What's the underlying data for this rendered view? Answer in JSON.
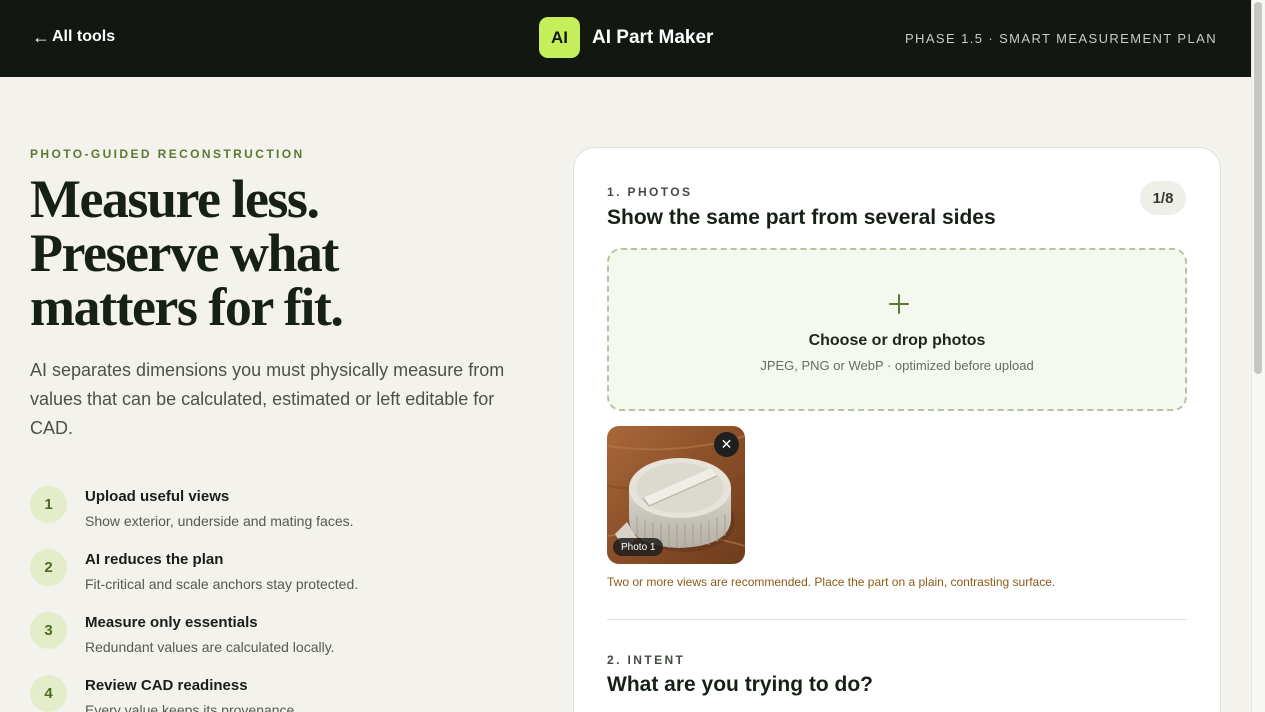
{
  "nav": {
    "back_arrow": "←",
    "back_label": "All tools",
    "logo_text": "AI",
    "app_name": "AI Part Maker",
    "phase_label": "PHASE 1.5 · SMART MEASUREMENT PLAN"
  },
  "hero": {
    "eyebrow": "PHOTO-GUIDED RECONSTRUCTION",
    "title_lines": [
      "Measure less.",
      "Preserve what",
      "matters for fit."
    ],
    "lead": "AI separates dimensions you must physically measure from values that can be calculated, estimated or left editable for CAD."
  },
  "steps": [
    {
      "number": "1",
      "title": "Upload useful views",
      "description": "Show exterior, underside and mating faces."
    },
    {
      "number": "2",
      "title": "AI reduces the plan",
      "description": "Fit-critical and scale anchors stay protected."
    },
    {
      "number": "3",
      "title": "Measure only essentials",
      "description": "Redundant values are calculated locally."
    },
    {
      "number": "4",
      "title": "Review CAD readiness",
      "description": "Every value keeps its provenance."
    }
  ],
  "photos_section": {
    "label": "1. PHOTOS",
    "title": "Show the same part from several sides",
    "count": "1/8",
    "dropzone": {
      "icon": "plus-icon",
      "title": "Choose or drop photos",
      "subtitle": "JPEG, PNG or WebP · optimized before upload"
    },
    "photos": [
      {
        "label": "Photo 1",
        "remove_glyph": "✕"
      }
    ],
    "hint": "Two or more views are recommended. Place the part on a plain, contrasting surface."
  },
  "intent_section": {
    "label": "2. INTENT",
    "title": "What are you trying to do?"
  },
  "colors": {
    "topbar": "#121712",
    "accent_lime": "#c4ef5a",
    "accent_green": "#5b7a2e",
    "hint_text": "#8a5a14",
    "background": "#f3f2ec"
  }
}
